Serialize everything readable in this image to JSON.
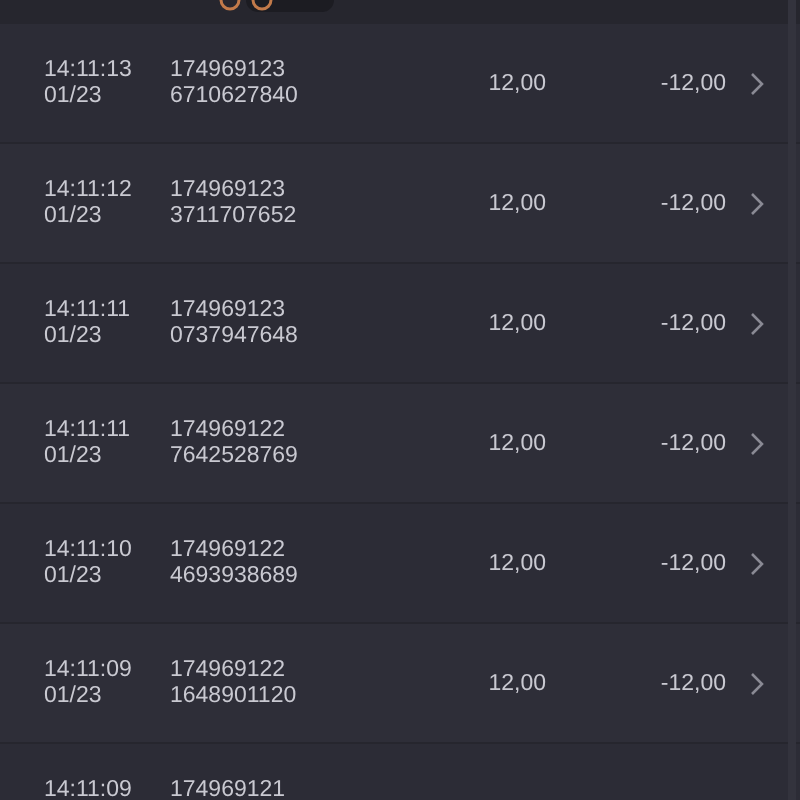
{
  "rows": [
    {
      "time": "14:11:13",
      "date": "01/23",
      "id_line_1": "174969123",
      "id_line_2": "6710627840",
      "amount": "12,00",
      "change": "-12,00"
    },
    {
      "time": "14:11:12",
      "date": "01/23",
      "id_line_1": "174969123",
      "id_line_2": "3711707652",
      "amount": "12,00",
      "change": "-12,00"
    },
    {
      "time": "14:11:11",
      "date": "01/23",
      "id_line_1": "174969123",
      "id_line_2": "0737947648",
      "amount": "12,00",
      "change": "-12,00"
    },
    {
      "time": "14:11:11",
      "date": "01/23",
      "id_line_1": "174969122",
      "id_line_2": "7642528769",
      "amount": "12,00",
      "change": "-12,00"
    },
    {
      "time": "14:11:10",
      "date": "01/23",
      "id_line_1": "174969122",
      "id_line_2": "4693938689",
      "amount": "12,00",
      "change": "-12,00"
    },
    {
      "time": "14:11:09",
      "date": "01/23",
      "id_line_1": "174969122",
      "id_line_2": "1648901120",
      "amount": "12,00",
      "change": "-12,00"
    },
    {
      "time": "14:11:09",
      "id_line_1": "174969121"
    }
  ]
}
